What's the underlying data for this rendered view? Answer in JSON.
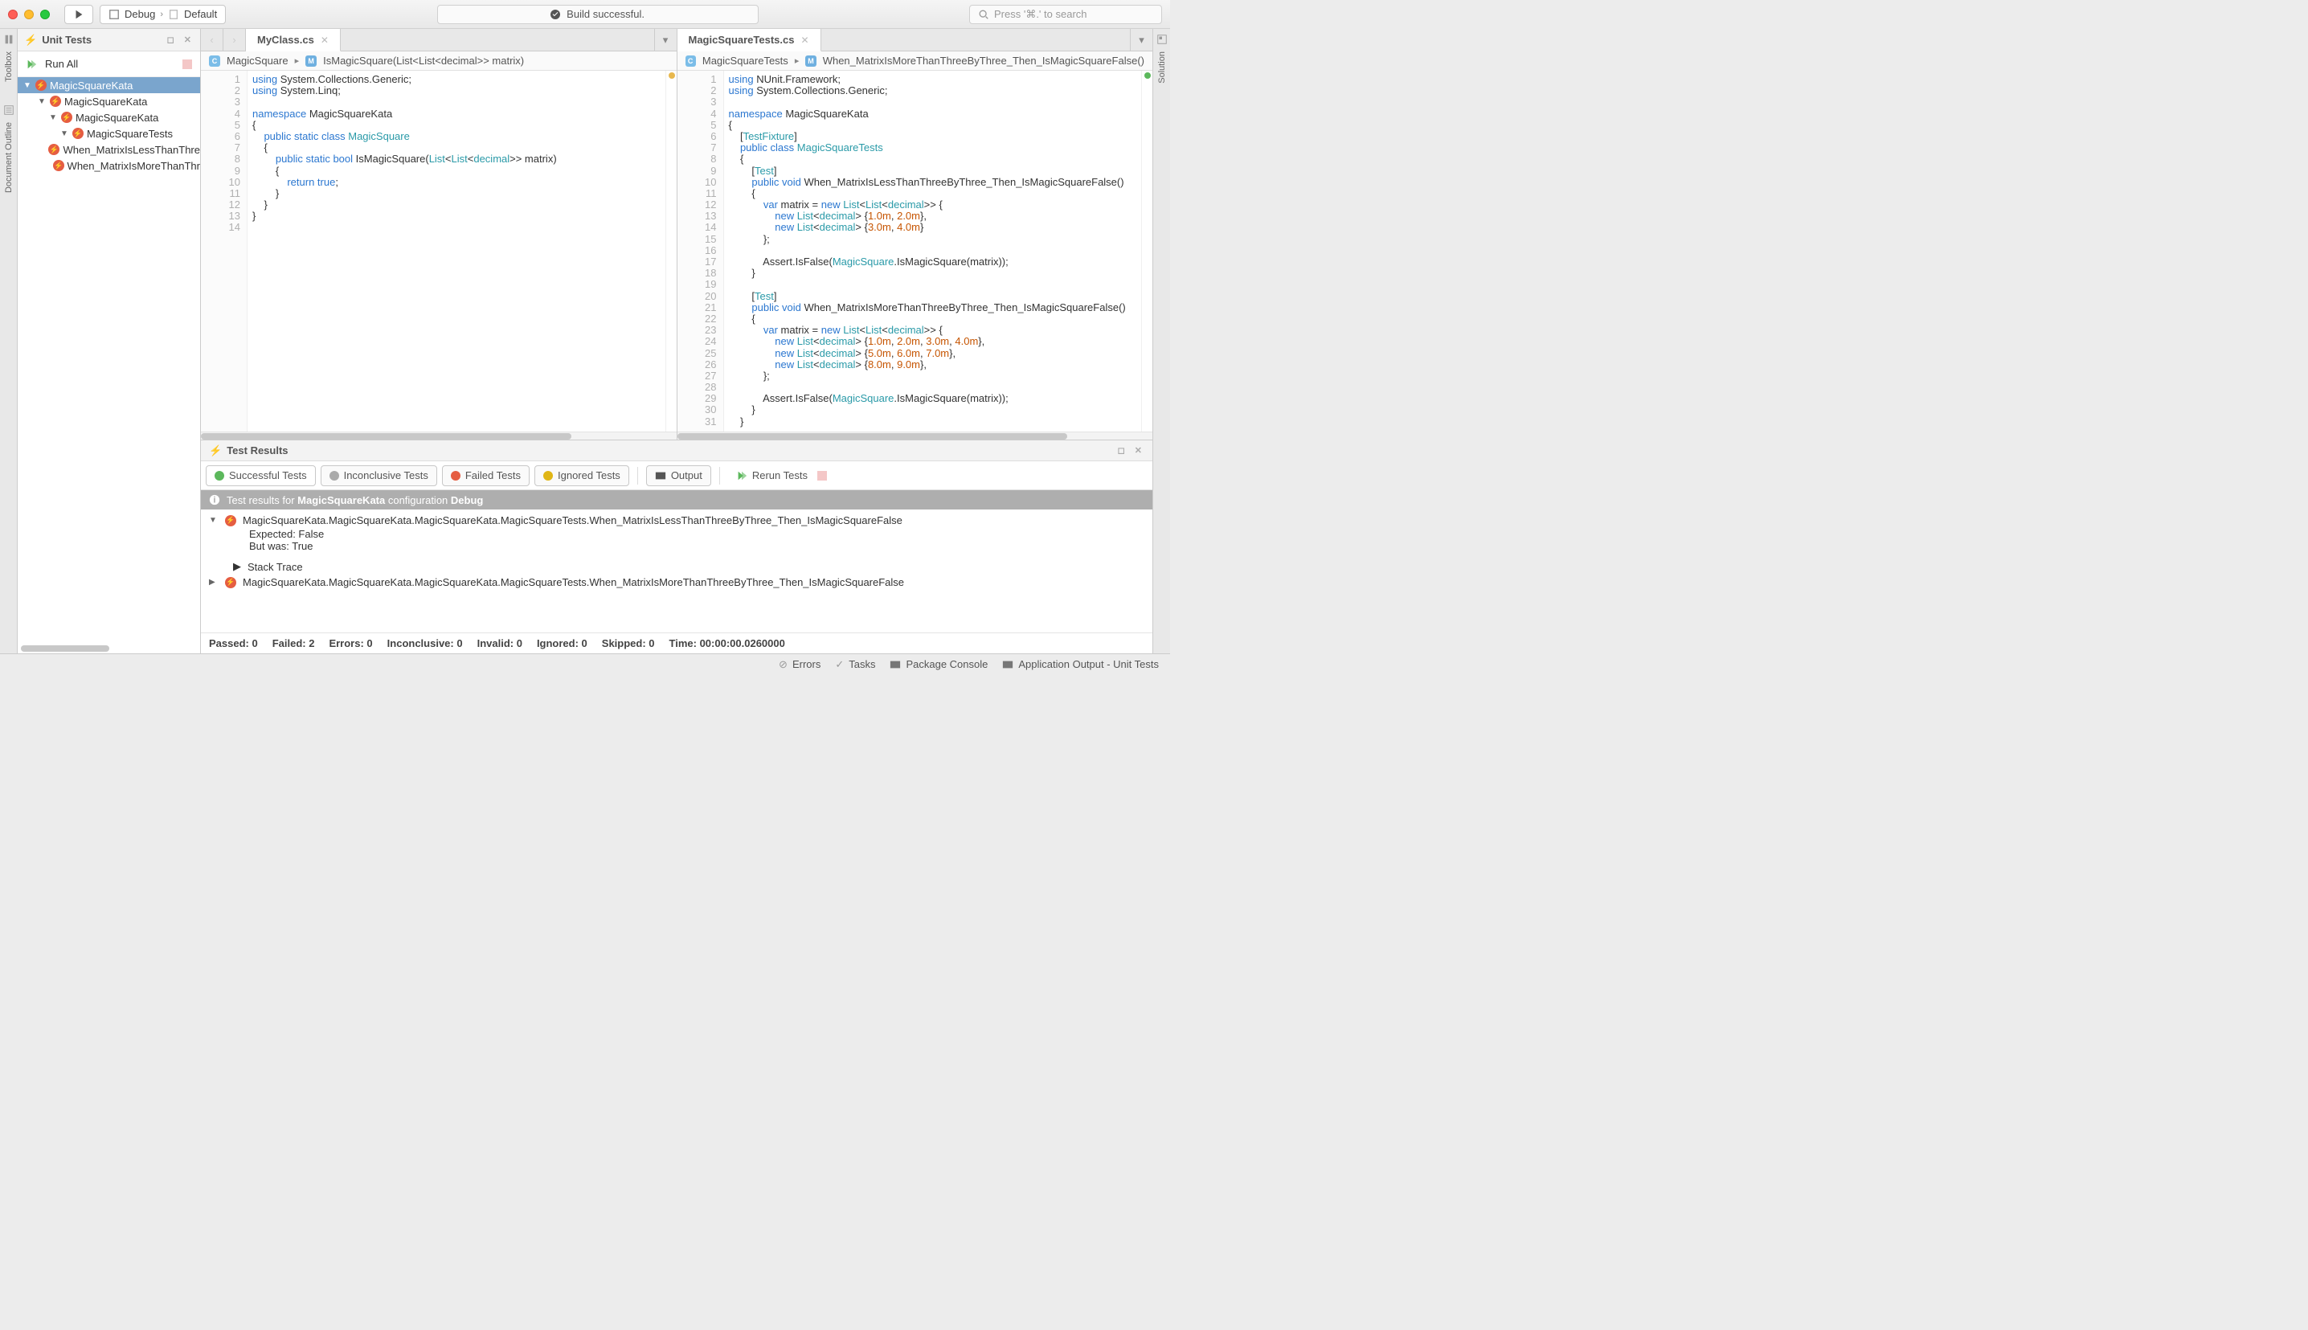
{
  "titlebar": {
    "debug_label": "Debug",
    "default_label": "Default",
    "build_status": "Build successful.",
    "search_placeholder": "Press '⌘.' to search"
  },
  "left_strip": {
    "toolbox": "Toolbox",
    "doc_outline": "Document Outline"
  },
  "right_strip": {
    "solution": "Solution"
  },
  "unit_tests": {
    "title": "Unit Tests",
    "run_all": "Run All",
    "tree": {
      "root": "MagicSquareKata",
      "l1": "MagicSquareKata",
      "l2": "MagicSquareKata",
      "l3": "MagicSquareTests",
      "test1": "When_MatrixIsLessThanThre",
      "test2": "When_MatrixIsMoreThanThr"
    }
  },
  "tabs": {
    "left": "MyClass.cs",
    "right": "MagicSquareTests.cs"
  },
  "breadcrumbs": {
    "left": {
      "a": "MagicSquare",
      "b": "IsMagicSquare(List<List<decimal>> matrix)"
    },
    "right": {
      "a": "MagicSquareTests",
      "b": "When_MatrixIsMoreThanThreeByThree_Then_IsMagicSquareFalse()"
    }
  },
  "results": {
    "title": "Test Results",
    "filters": {
      "successful": "Successful Tests",
      "inconclusive": "Inconclusive Tests",
      "failed": "Failed Tests",
      "ignored": "Ignored Tests",
      "output": "Output",
      "rerun": "Rerun Tests"
    },
    "info_prefix": "Test results for ",
    "info_project": "MagicSquareKata",
    "info_mid": " configuration ",
    "info_config": "Debug",
    "row1": "MagicSquareKata.MagicSquareKata.MagicSquareKata.MagicSquareTests.When_MatrixIsLessThanThreeByThree_Then_IsMagicSquareFalse",
    "detail_l1": "  Expected: False",
    "detail_l2": "  But was:  True",
    "stack": "Stack Trace",
    "row2": "MagicSquareKata.MagicSquareKata.MagicSquareKata.MagicSquareTests.When_MatrixIsMoreThanThreeByThree_Then_IsMagicSquareFalse",
    "summary": {
      "passed": "Passed: 0",
      "failed": "Failed: 2",
      "errors": "Errors: 0",
      "inconclusive": "Inconclusive: 0",
      "invalid": "Invalid: 0",
      "ignored": "Ignored: 0",
      "skipped": "Skipped: 0",
      "time": "Time: 00:00:00.0260000"
    }
  },
  "statusbar": {
    "errors": "Errors",
    "tasks": "Tasks",
    "package": "Package Console",
    "output": "Application Output - Unit Tests"
  }
}
